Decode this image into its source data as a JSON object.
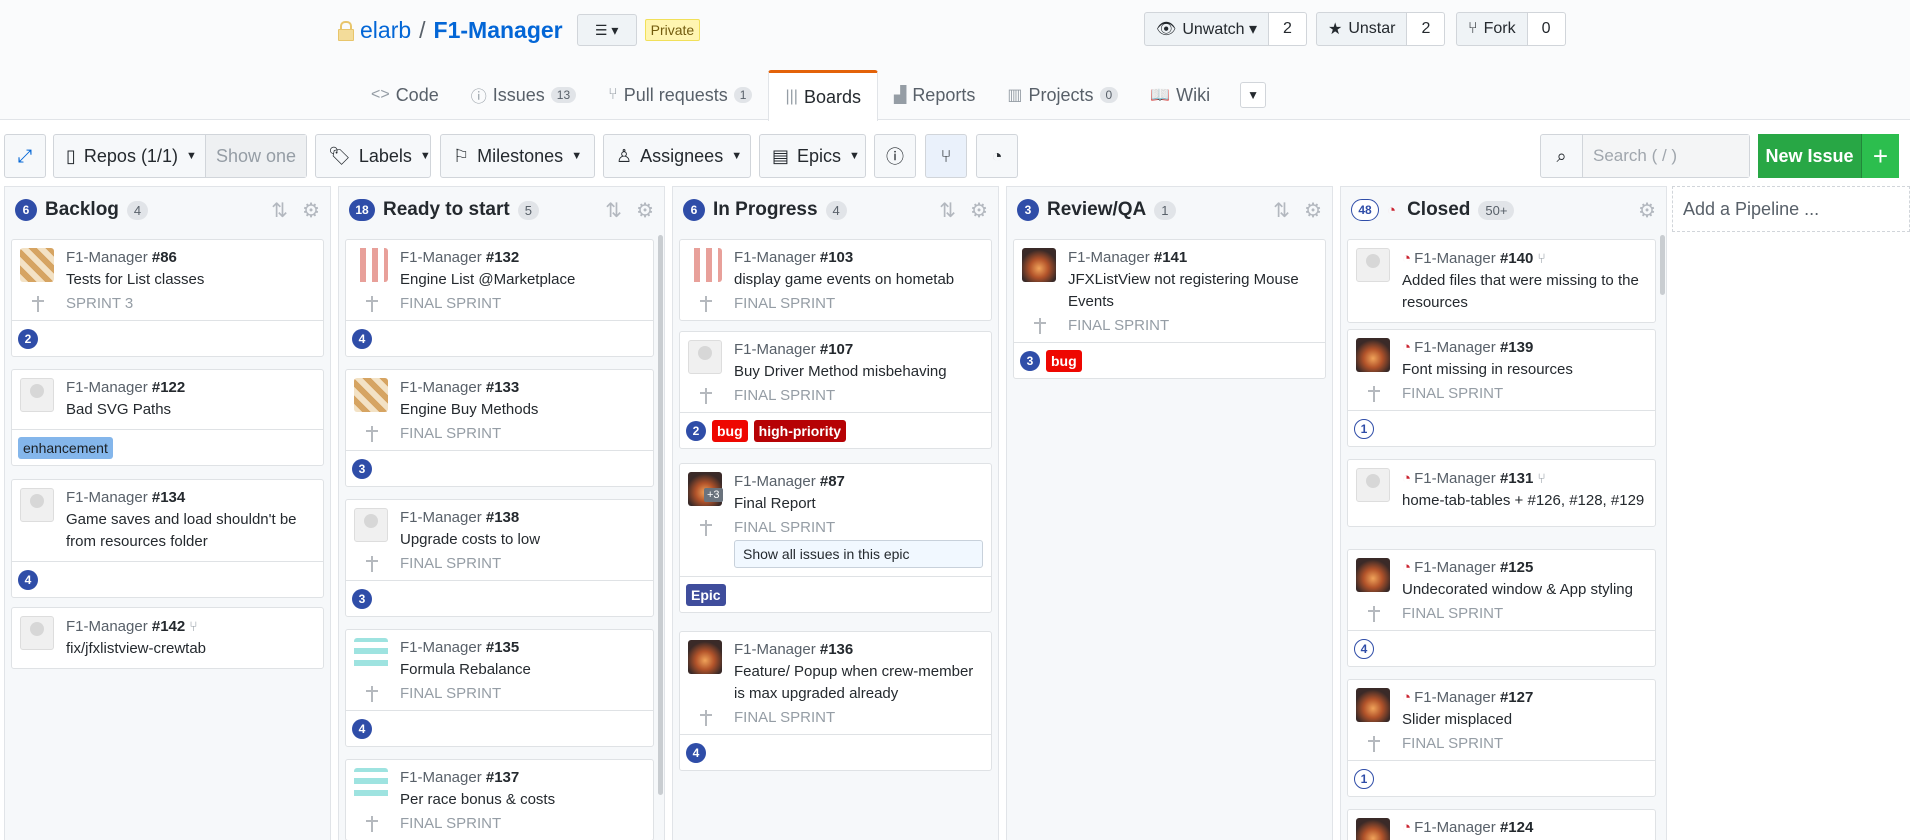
{
  "repo": {
    "owner": "elarb",
    "sep": "/",
    "name": "F1-Manager",
    "badge": "Private"
  },
  "actions": [
    {
      "label": "Unwatch ▾",
      "count": "2",
      "icon": "eye-icon"
    },
    {
      "label": "Unstar",
      "count": "2",
      "icon": "star-icon"
    },
    {
      "label": "Fork",
      "count": "0",
      "icon": "fork-icon"
    }
  ],
  "tabs": [
    {
      "label": "Code",
      "icon": "code-icon",
      "count": ""
    },
    {
      "label": "Issues",
      "icon": "issue-icon",
      "count": "13"
    },
    {
      "label": "Pull requests",
      "icon": "pr-icon",
      "count": "1"
    },
    {
      "label": "Boards",
      "icon": "boards-icon",
      "count": "",
      "active": true
    },
    {
      "label": "Reports",
      "icon": "reports-icon",
      "count": ""
    },
    {
      "label": "Projects",
      "icon": "projects-icon",
      "count": "0"
    },
    {
      "label": "Wiki",
      "icon": "wiki-icon",
      "count": ""
    }
  ],
  "toolbar": {
    "repos": "Repos (1/1)",
    "show_one": "Show one",
    "labels": "Labels",
    "milestones": "Milestones",
    "assignees": "Assignees",
    "epics": "Epics",
    "search_placeholder": "Search ( / )",
    "new_issue": "New Issue",
    "add_pipeline": "Add a Pipeline ..."
  },
  "pipelines": [
    {
      "name": "Backlog",
      "points": "6",
      "count": "4"
    },
    {
      "name": "Ready to start",
      "points": "18",
      "count": "5"
    },
    {
      "name": "In Progress",
      "points": "6",
      "count": "4"
    },
    {
      "name": "Review/QA",
      "points": "3",
      "count": "1"
    },
    {
      "name": "Closed",
      "points": "48",
      "count": "50+"
    }
  ],
  "cards": {
    "repo": "F1-Manager",
    "c86": {
      "num": "#86",
      "title": "Tests for List classes",
      "sprint": "SPRINT 3",
      "est": "2"
    },
    "c122": {
      "num": "#122",
      "title": "Bad SVG Paths",
      "label": "enhancement"
    },
    "c134": {
      "num": "#134",
      "title": "Game saves and load shouldn't be from resources folder",
      "est": "4"
    },
    "c142": {
      "num": "#142",
      "title": "fix/jfxlistview-crewtab"
    },
    "c132": {
      "num": "#132",
      "title": "Engine List @Marketplace",
      "sprint": "FINAL SPRINT",
      "est": "4"
    },
    "c133": {
      "num": "#133",
      "title": "Engine Buy Methods",
      "sprint": "FINAL SPRINT",
      "est": "3"
    },
    "c138": {
      "num": "#138",
      "title": "Upgrade costs to low",
      "sprint": "FINAL SPRINT",
      "est": "3"
    },
    "c135": {
      "num": "#135",
      "title": "Formula Rebalance",
      "sprint": "FINAL SPRINT",
      "est": "4"
    },
    "c137": {
      "num": "#137",
      "title": "Per race bonus & costs",
      "sprint": "FINAL SPRINT"
    },
    "c103": {
      "num": "#103",
      "title": "display game events on hometab",
      "sprint": "FINAL SPRINT"
    },
    "c107": {
      "num": "#107",
      "title": "Buy Driver Method misbehaving",
      "sprint": "FINAL SPRINT",
      "est": "2",
      "label1": "bug",
      "label2": "high-priority"
    },
    "c87": {
      "num": "#87",
      "title": "Final Report",
      "sprint": "FINAL SPRINT",
      "epic_btn": "Show all issues in this epic",
      "label": "Epic",
      "more": "+3"
    },
    "c136": {
      "num": "#136",
      "title": "Feature/ Popup when crew-member is max upgraded already",
      "sprint": "FINAL SPRINT",
      "est": "4"
    },
    "c141": {
      "num": "#141",
      "title": "JFXListView not registering Mouse Events",
      "sprint": "FINAL SPRINT",
      "est": "3",
      "label": "bug"
    },
    "c140": {
      "num": "#140",
      "title": "Added files that were missing to the resources"
    },
    "c139": {
      "num": "#139",
      "title": "Font missing in resources",
      "sprint": "FINAL SPRINT",
      "est": "1"
    },
    "c131": {
      "num": "#131",
      "title": "home-tab-tables + #126, #128, #129"
    },
    "c125": {
      "num": "#125",
      "title": "Undecorated window & App styling",
      "sprint": "FINAL SPRINT",
      "est": "4"
    },
    "c127": {
      "num": "#127",
      "title": "Slider misplaced",
      "sprint": "FINAL SPRINT",
      "est": "1"
    },
    "c124": {
      "num": "#124"
    }
  }
}
